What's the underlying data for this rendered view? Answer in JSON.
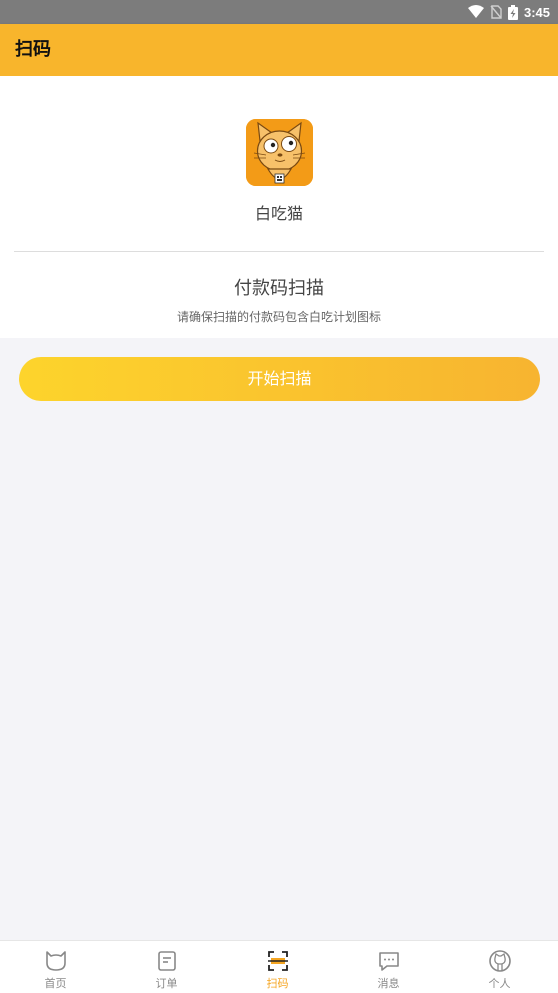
{
  "status_bar": {
    "time": "3:45"
  },
  "header": {
    "title": "扫码"
  },
  "app": {
    "name": "白吃猫"
  },
  "scan": {
    "title": "付款码扫描",
    "description": "请确保扫描的付款码包含白吃计划图标",
    "button_label": "开始扫描"
  },
  "nav": {
    "items": [
      {
        "label": "首页",
        "icon": "cat-head-icon"
      },
      {
        "label": "订单",
        "icon": "order-list-icon"
      },
      {
        "label": "扫码",
        "icon": "scan-icon"
      },
      {
        "label": "消息",
        "icon": "message-icon"
      },
      {
        "label": "个人",
        "icon": "profile-icon"
      }
    ],
    "active_index": 2
  },
  "colors": {
    "accent": "#f8b52c",
    "button_start": "#fdd42c",
    "button_end": "#f7b430",
    "active_tab": "#f5a623"
  }
}
